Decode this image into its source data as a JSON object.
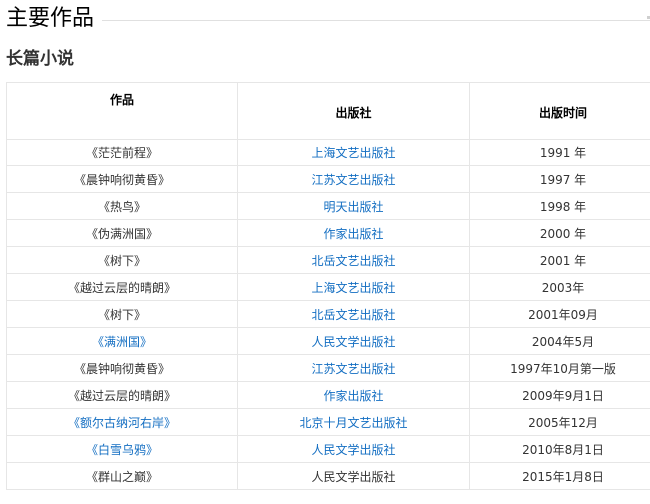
{
  "section_title": "主要作品",
  "subsection_title": "长篇小说",
  "table": {
    "headers": {
      "work": "作品",
      "publisher": "出版社",
      "date": "出版时间"
    },
    "rows": [
      {
        "work": "《茫茫前程》",
        "work_link": false,
        "publisher": "上海文艺出版社",
        "publisher_link": true,
        "date": "1991 年"
      },
      {
        "work": "《晨钟响彻黄昏》",
        "work_link": false,
        "publisher": "江苏文艺出版社",
        "publisher_link": true,
        "date": "1997 年"
      },
      {
        "work": "《热鸟》",
        "work_link": false,
        "publisher": "明天出版社",
        "publisher_link": true,
        "date": "1998 年"
      },
      {
        "work": "《伪满洲国》",
        "work_link": false,
        "publisher": "作家出版社",
        "publisher_link": true,
        "date": "2000 年"
      },
      {
        "work": "《树下》",
        "work_link": false,
        "publisher": "北岳文艺出版社",
        "publisher_link": true,
        "date": "2001 年"
      },
      {
        "work": "《越过云层的晴朗》",
        "work_link": false,
        "publisher": "上海文艺出版社",
        "publisher_link": true,
        "date": "2003年"
      },
      {
        "work": "《树下》",
        "work_link": false,
        "publisher": "北岳文艺出版社",
        "publisher_link": true,
        "date": "2001年09月"
      },
      {
        "work": "《满洲国》",
        "work_link": true,
        "publisher": "人民文学出版社",
        "publisher_link": true,
        "date": "2004年5月"
      },
      {
        "work": "《晨钟响彻黄昏》",
        "work_link": false,
        "publisher": "江苏文艺出版社",
        "publisher_link": true,
        "date": "1997年10月第一版"
      },
      {
        "work": "《越过云层的晴朗》",
        "work_link": false,
        "publisher": "作家出版社",
        "publisher_link": true,
        "date": "2009年9月1日"
      },
      {
        "work": "《额尔古纳河右岸》",
        "work_link": true,
        "publisher": "北京十月文艺出版社",
        "publisher_link": true,
        "date": "2005年12月"
      },
      {
        "work": "《白雪乌鸦》",
        "work_link": true,
        "publisher": "人民文学出版社",
        "publisher_link": true,
        "date": "2010年8月1日"
      },
      {
        "work": "《群山之巅》",
        "work_link": false,
        "publisher": "人民文学出版社",
        "publisher_link": false,
        "date": "2015年1月8日"
      }
    ]
  },
  "colors": {
    "link": "#136ec2",
    "text": "#333333",
    "border": "#e6e6e6"
  }
}
